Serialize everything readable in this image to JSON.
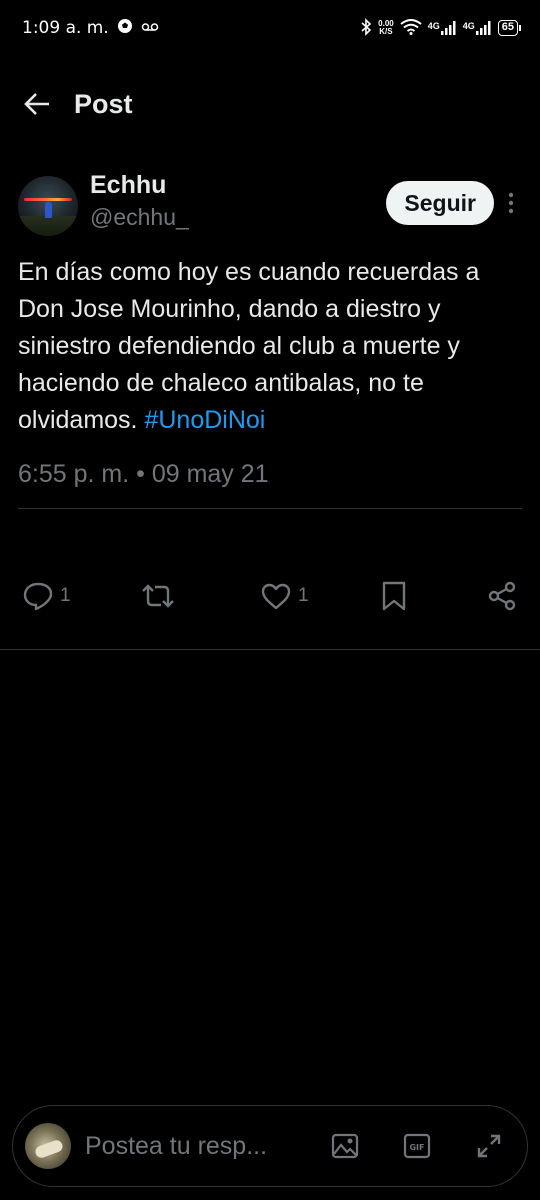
{
  "status_bar": {
    "time": "1:09 a. m.",
    "net_speed": "0.00",
    "net_unit": "K/S",
    "net1": "4G",
    "net2": "4G",
    "battery": "65"
  },
  "header": {
    "title": "Post"
  },
  "post": {
    "author_name": "Echhu",
    "author_handle": "@echhu_",
    "follow_label": "Seguir",
    "text": "En días como hoy es cuando recuerdas a Don Jose Mourinho, dando a diestro y siniestro defendiendo al club a muerte y haciendo de chaleco antibalas, no te olvidamos.",
    "hashtag": "#UnoDiNoi",
    "timestamp": "6:55 p. m. • 09 may 21"
  },
  "actions": {
    "reply_count": "1",
    "repost_count": "",
    "like_count": "1"
  },
  "compose": {
    "placeholder": "Postea tu resp..."
  },
  "colors": {
    "accent": "#1d9bf0",
    "muted": "#71767b",
    "text": "#e7e9ea",
    "background": "#000000"
  }
}
